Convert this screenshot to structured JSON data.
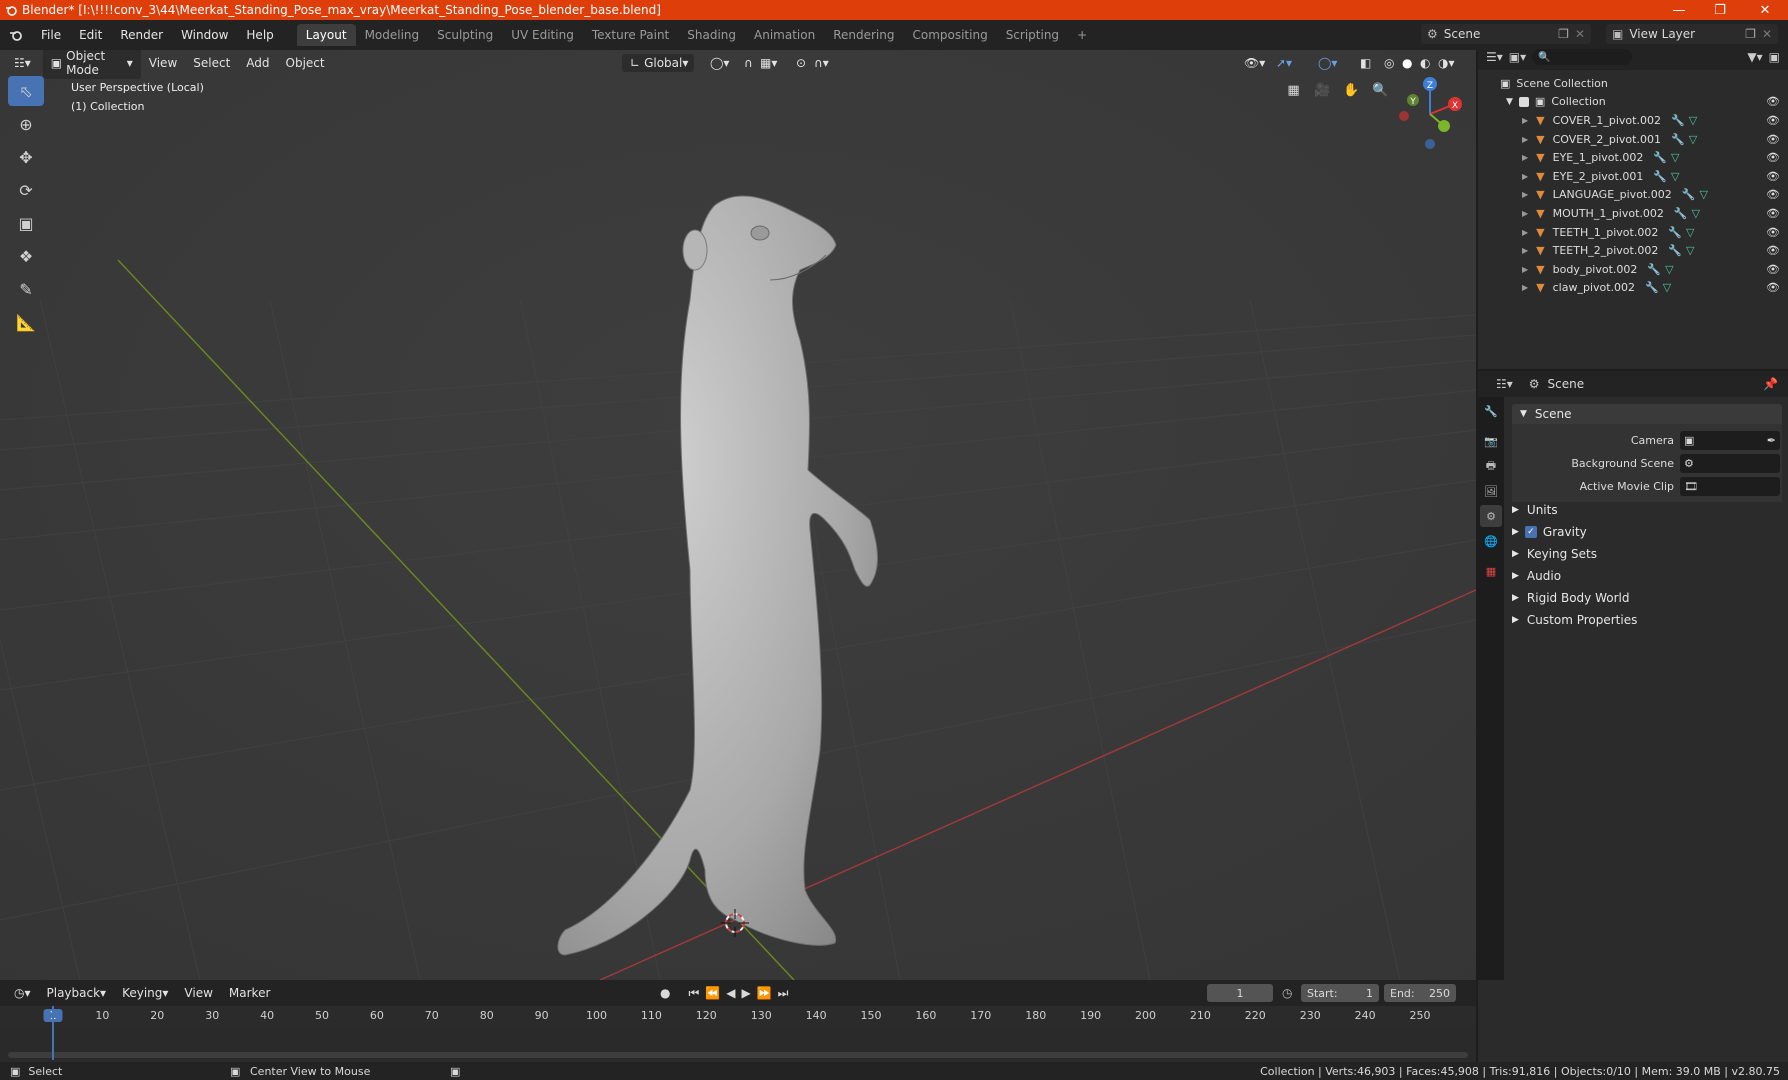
{
  "titlebar": {
    "title": "Blender* [I:\\!!!!conv_3\\44\\Meerkat_Standing_Pose_max_vray\\Meerkat_Standing_Pose_blender_base.blend]"
  },
  "menu": {
    "items": [
      "File",
      "Edit",
      "Render",
      "Window",
      "Help"
    ]
  },
  "workspaces": [
    "Layout",
    "Modeling",
    "Sculpting",
    "UV Editing",
    "Texture Paint",
    "Shading",
    "Animation",
    "Rendering",
    "Compositing",
    "Scripting"
  ],
  "active_workspace": "Layout",
  "scene_selector": "Scene",
  "view_layer": "View Layer",
  "viewport": {
    "mode": "Object Mode",
    "menus": [
      "View",
      "Select",
      "Add",
      "Object"
    ],
    "orientation": "Global",
    "info_line1": "User Perspective (Local)",
    "info_line2": "(1) Collection",
    "gizmo": {
      "x": "X",
      "y": "Y",
      "z": "Z"
    }
  },
  "outliner": {
    "root": "Scene Collection",
    "collection": "Collection",
    "objects": [
      "COVER_1_pivot.002",
      "COVER_2_pivot.001",
      "EYE_1_pivot.002",
      "EYE_2_pivot.001",
      "LANGUAGE_pivot.002",
      "MOUTH_1_pivot.002",
      "TEETH_1_pivot.002",
      "TEETH_2_pivot.002",
      "body_pivot.002",
      "claw_pivot.002"
    ]
  },
  "properties": {
    "context": "Scene",
    "panel_title": "Scene",
    "camera_label": "Camera",
    "bg_scene_label": "Background Scene",
    "movie_clip_label": "Active Movie Clip",
    "subpanels": [
      "Units",
      "Gravity",
      "Keying Sets",
      "Audio",
      "Rigid Body World",
      "Custom Properties"
    ],
    "gravity_checked": true
  },
  "timeline": {
    "menus": [
      "Playback",
      "Keying",
      "View",
      "Marker"
    ],
    "current_frame": "1",
    "start_label": "Start:",
    "start": "1",
    "end_label": "End:",
    "end": "250",
    "ruler": [
      "1",
      "10",
      "20",
      "30",
      "40",
      "50",
      "60",
      "70",
      "80",
      "90",
      "100",
      "110",
      "120",
      "130",
      "140",
      "150",
      "160",
      "170",
      "180",
      "190",
      "200",
      "210",
      "220",
      "230",
      "240",
      "250"
    ]
  },
  "status": {
    "left": "Select",
    "middle": "Center View to Mouse",
    "right": "Collection | Verts:46,903 | Faces:45,908 | Tris:91,816 | Objects:0/10 | Mem: 39.0 MB | v2.80.75"
  }
}
